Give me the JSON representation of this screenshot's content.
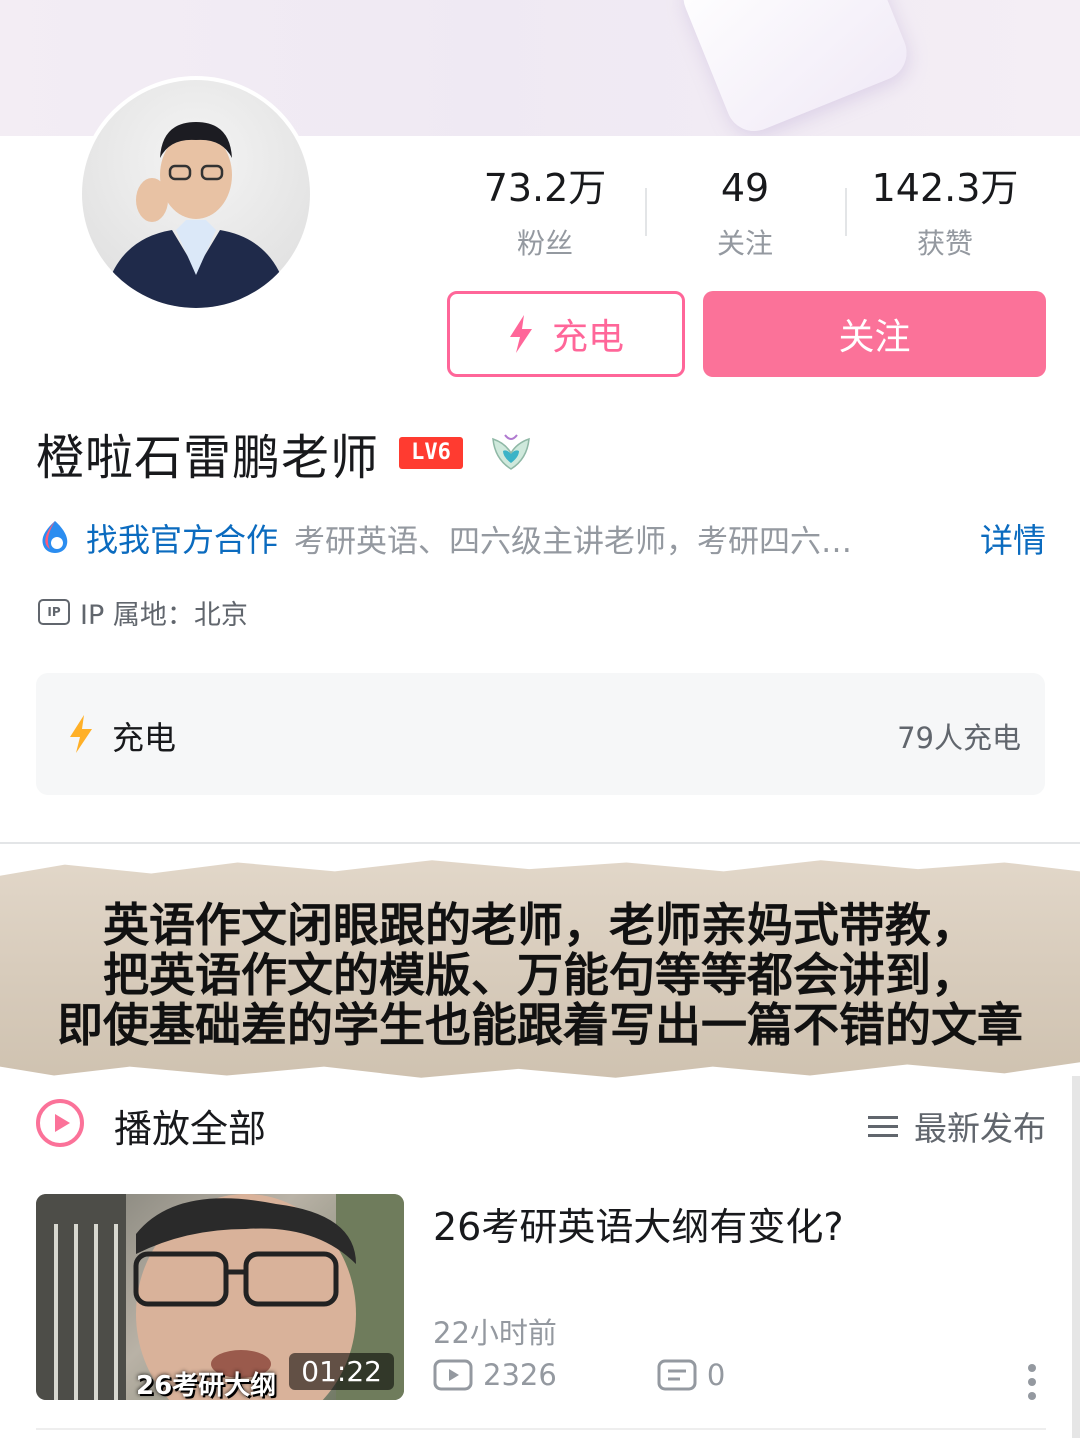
{
  "profile": {
    "name": "橙啦石雷鹏老师",
    "level_badge": "LV6",
    "avatar_icon": "avatar-photo"
  },
  "stats": [
    {
      "value": "73.2万",
      "label": "粉丝"
    },
    {
      "value": "49",
      "label": "关注"
    },
    {
      "value": "142.3万",
      "label": "获赞"
    }
  ],
  "actions": {
    "charge_label": "充电",
    "follow_label": "关注"
  },
  "cooperation": {
    "link_text": "找我官方合作",
    "description": "考研英语、四六级主讲老师，考研四六…",
    "detail_label": "详情"
  },
  "ip": {
    "icon_text": "IP",
    "text": "IP 属地：北京"
  },
  "charge_card": {
    "title": "充电",
    "count": "79人充电"
  },
  "banner_text": {
    "line1": "英语作文闭眼跟的老师，老师亲妈式带教，",
    "line2": "把英语作文的模版、万能句等等都会讲到，",
    "line3": "即使基础差的学生也能跟着写出一篇不错的文章"
  },
  "list_header": {
    "play_all": "播放全部",
    "sort_label": "最新发布"
  },
  "video": {
    "title": "26考研英语大纲有变化?",
    "thumb_caption": "26考研大纲",
    "duration": "01:22",
    "time_ago": "22小时前",
    "views": "2326",
    "comments": "0"
  },
  "colors": {
    "accent_pink": "#fb7299",
    "link_blue": "#0b6bbf",
    "charge_yellow": "#ffb027"
  }
}
